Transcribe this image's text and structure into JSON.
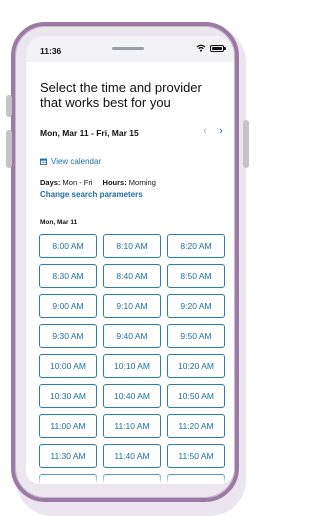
{
  "status_bar": {
    "time": "11:36"
  },
  "header": {
    "title": "Select the time and provider that works best for you"
  },
  "date_range": {
    "label": "Mon, Mar 11 - Fri, Mar 15",
    "prev_icon": "chevron-left-icon",
    "next_icon": "chevron-right-icon"
  },
  "view_calendar": {
    "label": "View calendar",
    "icon": "calendar-icon"
  },
  "filters": {
    "days_label": "Days:",
    "days_value": "Mon - Fri",
    "hours_label": "Hours:",
    "hours_value": "Morning"
  },
  "change_search": {
    "label": "Change search parameters"
  },
  "day": {
    "label": "Mon, Mar 11"
  },
  "slots": [
    "8:00 AM",
    "8:10 AM",
    "8:20 AM",
    "8:30 AM",
    "8:40 AM",
    "8:50 AM",
    "9:00 AM",
    "9:10 AM",
    "9:20 AM",
    "9:30 AM",
    "9:40 AM",
    "9:50 AM",
    "10:00 AM",
    "10:10 AM",
    "10:20 AM",
    "10:30 AM",
    "10:40 AM",
    "10:50 AM",
    "11:00 AM",
    "11:10 AM",
    "11:20 AM",
    "11:30 AM",
    "11:40 AM",
    "11:50 AM",
    "",
    "",
    ""
  ],
  "colors": {
    "accent": "#1d6fa5",
    "frame": "#9b7aa6"
  }
}
